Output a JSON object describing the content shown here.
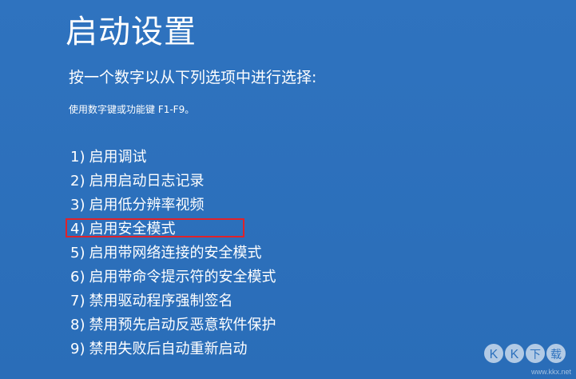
{
  "screen": {
    "title": "启动设置",
    "subtitle": "按一个数字以从下列选项中进行选择:",
    "hint": "使用数字键或功能键 F1-F9。"
  },
  "options": [
    {
      "number": "1)",
      "label": "启用调试"
    },
    {
      "number": "2)",
      "label": "启用启动日志记录"
    },
    {
      "number": "3)",
      "label": "启用低分辨率视频"
    },
    {
      "number": "4)",
      "label": "启用安全模式"
    },
    {
      "number": "5)",
      "label": "启用带网络连接的安全模式"
    },
    {
      "number": "6)",
      "label": "启用带命令提示符的安全模式"
    },
    {
      "number": "7)",
      "label": "禁用驱动程序强制签名"
    },
    {
      "number": "8)",
      "label": "禁用预先启动反恶意软件保护"
    },
    {
      "number": "9)",
      "label": "禁用失败后自动重新启动"
    }
  ],
  "watermark": {
    "text": "KK下载",
    "domain": "www.kkx.net"
  },
  "colors": {
    "background": "#2b6fba",
    "highlight_border": "#e0222a",
    "text": "#ffffff"
  },
  "icons": {
    "watermark_logo": "kk-download-watermark"
  }
}
